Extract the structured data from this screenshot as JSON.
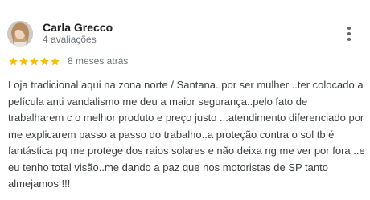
{
  "review": {
    "reviewer_name": "Carla Grecco",
    "reviewer_meta": "4 avaliações",
    "rating": 5,
    "rating_max": 5,
    "date": "8 meses atrás",
    "text": "Loja tradicional aqui na zona norte / Santana..por ser mulher ..ter colocado a película anti vandalismo me deu a maior segurança..pelo fato de trabalharem c o melhor produto e preço justo ...atendimento diferenciado por me explicarem passo a passo do trabalho..a proteção contra o sol tb é fantástica pq me protege dos raios solares e não deixa ng me ver por fora ..e eu tenho total visão..me dando a paz que nos motoristas de SP tanto almejamos !!!",
    "more_icon": "more-vert-icon",
    "star_icon": "star-icon"
  },
  "colors": {
    "star": "#fbbc04",
    "meta_text": "#70757a",
    "body_text": "#3c4043",
    "icon": "#5f6368"
  }
}
